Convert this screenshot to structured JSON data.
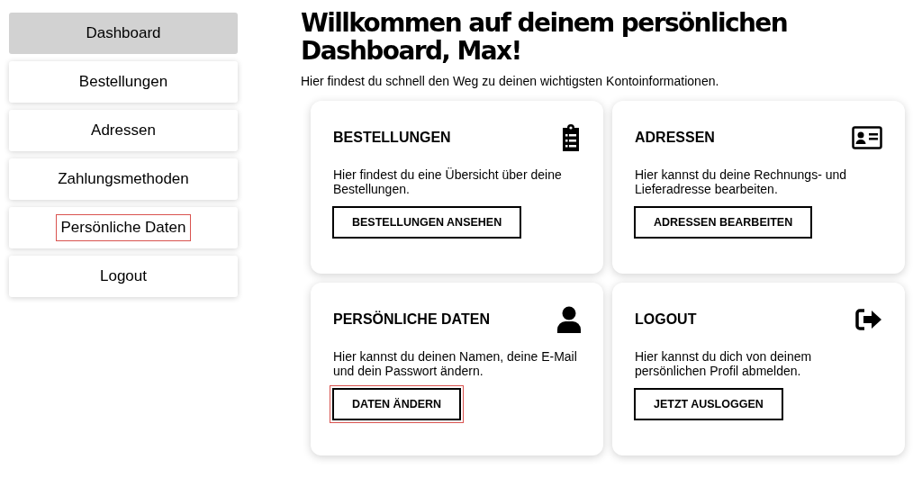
{
  "sidebar": {
    "items": [
      {
        "label": "Dashboard",
        "selected": true,
        "highlighted": false
      },
      {
        "label": "Bestellungen",
        "selected": false,
        "highlighted": false
      },
      {
        "label": "Adressen",
        "selected": false,
        "highlighted": false
      },
      {
        "label": "Zahlungsmethoden",
        "selected": false,
        "highlighted": false
      },
      {
        "label": "Persönliche Daten",
        "selected": false,
        "highlighted": true
      },
      {
        "label": "Logout",
        "selected": false,
        "highlighted": false
      }
    ]
  },
  "heading": "Willkommen auf deinem persönlichen Dashboard, Max!",
  "subtitle": "Hier findest du schnell den Weg zu deinen wichtigsten Kontoinformationen.",
  "cards": [
    {
      "kind": "clipboard",
      "title": "BESTELLUNGEN",
      "text": "Hier findest du eine Übersicht über deine Bestellungen.",
      "button": "BESTELLUNGEN ANSEHEN",
      "highlighted": false
    },
    {
      "kind": "idcard",
      "title": "ADRESSEN",
      "text": "Hier kannst du deine Rechnungs- und Lieferadresse bearbeiten.",
      "button": "ADRESSEN BEARBEITEN",
      "highlighted": false
    },
    {
      "kind": "user",
      "title": "PERSÖNLICHE DATEN",
      "text": "Hier kannst du deinen Namen, deine E-Mail und dein Passwort ändern.",
      "button": "DATEN ÄNDERN",
      "highlighted": true
    },
    {
      "kind": "signout",
      "title": "LOGOUT",
      "text": "Hier kannst du dich von deinem persönlichen Profil abmelden.",
      "button": "JETZT AUSLOGGEN",
      "highlighted": false
    }
  ]
}
